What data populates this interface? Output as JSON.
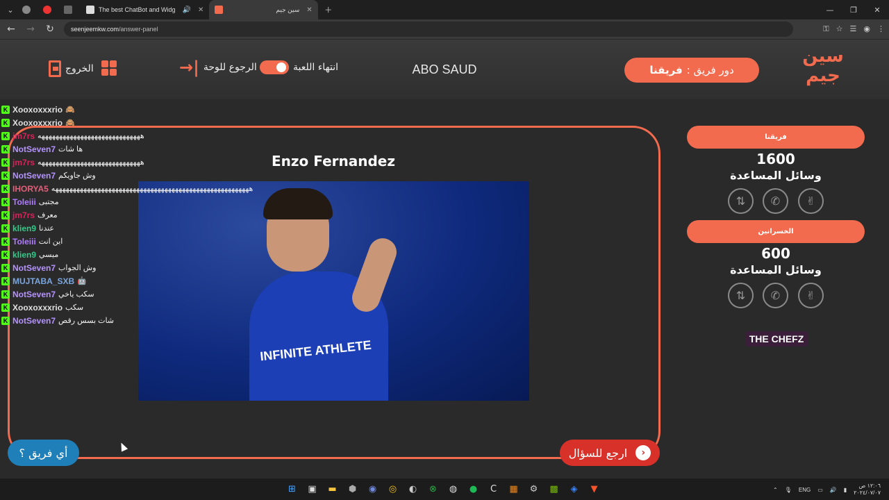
{
  "browser": {
    "tabs": [
      {
        "title": "The best ChatBot and Widg",
        "active": false
      },
      {
        "title": "سين جيم",
        "active": true
      }
    ],
    "url_host": "seenjeemkw.com",
    "url_path": "/answer-panel"
  },
  "header": {
    "logo_text": "سين جيم",
    "turn_prefix": "دور فريق :",
    "turn_team": "فريقنا",
    "player_name": "ABO SAUD",
    "end_game_label": "انتهاء اللعبة",
    "back_to_board_label": "الرجوع للوحة",
    "exit_label": "الخروج"
  },
  "chat": [
    {
      "user": "Xooxoxxxrio",
      "color": "#e0e0e0",
      "msg": "🙈"
    },
    {
      "user": "Xooxoxxxrio",
      "color": "#e0e0e0",
      "msg": "🙈"
    },
    {
      "user": "jm7rs",
      "color": "#d4245a",
      "msg": "هههههههههههههههههههههههههههههه"
    },
    {
      "user": "NotSeven7",
      "color": "#b593ff",
      "msg": "ها شات"
    },
    {
      "user": "jm7rs",
      "color": "#d4245a",
      "msg": "هههههههههههههههههههههههههههههه"
    },
    {
      "user": "NotSeven7",
      "color": "#b593ff",
      "msg": "وش جاويكم"
    },
    {
      "user": "IHORYA5",
      "color": "#e0607a",
      "msg": "ههههههههههههههههههههههههههههههههههههههههههههههههههههههههه"
    },
    {
      "user": "Toleiii",
      "color": "#b07cff",
      "msg": "مجتبى"
    },
    {
      "user": "jm7rs",
      "color": "#d4245a",
      "msg": "معرف"
    },
    {
      "user": "klien9",
      "color": "#34c98a",
      "msg": "عندنا"
    },
    {
      "user": "Toleiii",
      "color": "#b07cff",
      "msg": "اين انت"
    },
    {
      "user": "klien9",
      "color": "#34c98a",
      "msg": "ميسي"
    },
    {
      "user": "NotSeven7",
      "color": "#b593ff",
      "msg": "وش الجواب"
    },
    {
      "user": "MUJTABA_SXB",
      "color": "#7aa6e0",
      "msg": "🤖"
    },
    {
      "user": "NotSeven7",
      "color": "#b593ff",
      "msg": "سكب ياخي"
    },
    {
      "user": "Xooxoxxxrio",
      "color": "#e0e0e0",
      "msg": "سكب"
    },
    {
      "user": "NotSeven7",
      "color": "#b593ff",
      "msg": "شات بسس رقص"
    }
  ],
  "question": {
    "answer": "Enzo Fernandez",
    "image_sponsor": "INFINITE ATHLETE"
  },
  "buttons": {
    "back_to_question": "ارجع للسؤال",
    "which_team": "أي فريق ؟"
  },
  "teams": [
    {
      "name": "فريقنا",
      "score": "1600",
      "aids_label": "وسائل المساعدة"
    },
    {
      "name": "الخسرانين",
      "score": "600",
      "aids_label": "وسائل المساعدة"
    }
  ],
  "sponsor": "THE CHEFZ",
  "taskbar": {
    "lang": "ENG",
    "time": "١٢:٠٦ ص",
    "date": "٢٠٢٤/٠٧/٠٧"
  },
  "colors": {
    "accent": "#f26b4f",
    "back_button": "#d8312a",
    "which_button": "#1f7fb8"
  }
}
